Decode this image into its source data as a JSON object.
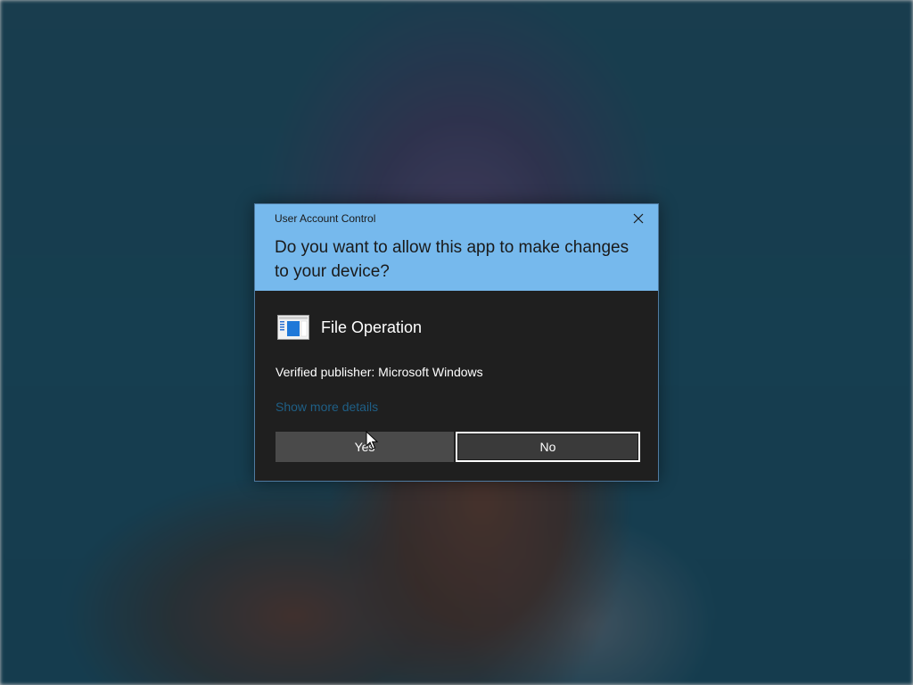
{
  "dialog": {
    "window_title": "User Account Control",
    "question": "Do you want to allow this app to make changes to your device?",
    "app_name": "File Operation",
    "app_icon": "window-app-icon",
    "publisher": "Verified publisher: Microsoft Windows",
    "more_details_link": "Show more details",
    "yes_label": "Yes",
    "no_label": "No",
    "close_icon": "close-icon"
  },
  "colors": {
    "header_bg": "#76b9ed",
    "body_bg": "#1f1f1f",
    "link": "#1f5f86",
    "yes_button_bg": "#4a4a4a",
    "no_button_border": "#ffffff",
    "desktop_bg": "#1c4c62"
  }
}
